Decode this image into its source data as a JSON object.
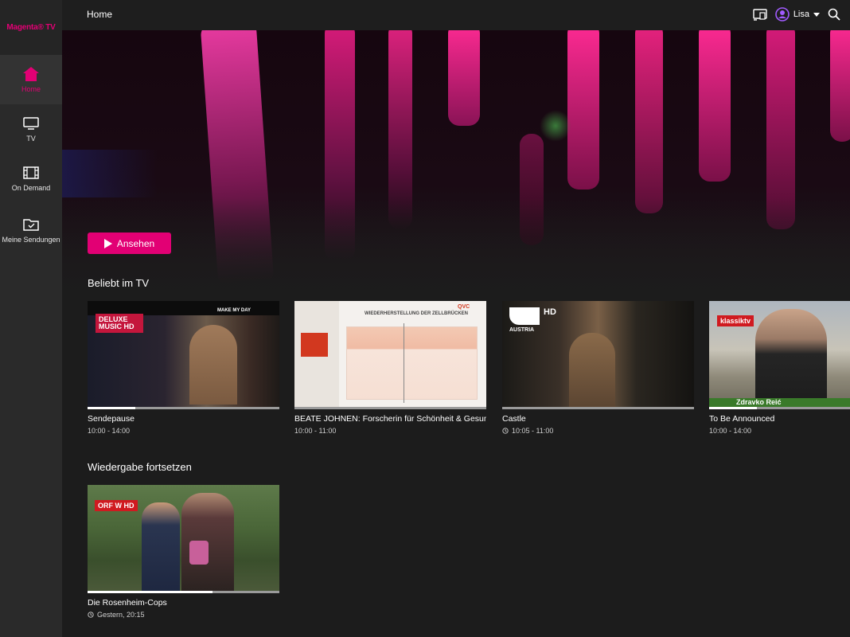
{
  "app": {
    "logo": "Magenta® TV",
    "page_title": "Home"
  },
  "sidebar": {
    "items": [
      {
        "label": "Home",
        "icon": "home-icon",
        "active": true
      },
      {
        "label": "TV",
        "icon": "tv-icon",
        "active": false
      },
      {
        "label": "On Demand",
        "icon": "film-icon",
        "active": false
      },
      {
        "label": "Meine Sendungen",
        "icon": "folder-check-icon",
        "active": false
      }
    ]
  },
  "topbar": {
    "user_name": "Lisa",
    "icons": [
      "cast-icon",
      "user-avatar-icon",
      "search-icon"
    ]
  },
  "hero": {
    "watch_label": "Ansehen",
    "accent": "#e20074"
  },
  "sections": [
    {
      "title": "Beliebt im TV",
      "cards": [
        {
          "title": "Sendepause",
          "time": "10:00 - 14:00",
          "channel_logo": "DELUXE MUSIC HD",
          "banner": "MAKE MY DAY",
          "progress": 0.25,
          "replay": false
        },
        {
          "title": "BEATE JOHNEN: Forscherin für Schönheit & Gesundheit",
          "time": "10:00 - 11:00",
          "channel_logo": "QVC",
          "banner": "WIEDERHERSTELLUNG DER ZELLBRÜCKEN",
          "progress": 0.0,
          "replay": false
        },
        {
          "title": "Castle",
          "time": "10:05 - 11:00",
          "channel_logo": "AUSTRIA",
          "badge": "HD",
          "progress": 0.0,
          "replay": true
        },
        {
          "title": "To Be Announced",
          "time": "10:00 - 14:00",
          "channel_logo": "klassiktv",
          "lower_third": "Zdravko Reić",
          "progress": 0.25,
          "replay": false
        }
      ]
    },
    {
      "title": "Wiedergabe fortsetzen",
      "cards": [
        {
          "title": "Die Rosenheim-Cops",
          "time": "Gestern, 20:15",
          "channel_logo": "ORF W HD",
          "progress": 0.65,
          "replay": true
        }
      ]
    }
  ]
}
